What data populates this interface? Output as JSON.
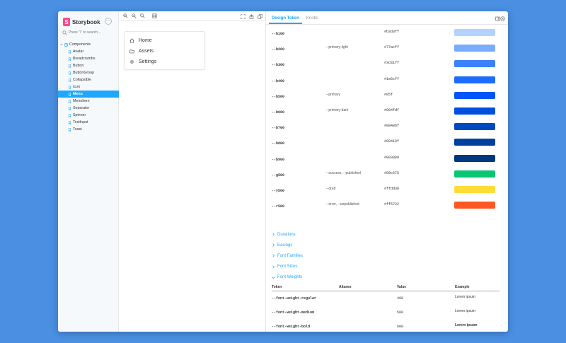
{
  "app": {
    "name": "Storybook",
    "logo_letter": "S",
    "menu_label": "···"
  },
  "search": {
    "placeholder": "Press \"/\" to search..."
  },
  "tree": {
    "root": "Components",
    "items": [
      "Avatar",
      "Breadcrumbs",
      "Button",
      "ButtonGroup",
      "Collapsible",
      "Icon",
      "Menu",
      "MenuItem",
      "Separator",
      "Spinner",
      "TextInput",
      "Toast"
    ],
    "active": "Menu"
  },
  "preview": {
    "nav": [
      {
        "label": "Home",
        "icon": "home-icon"
      },
      {
        "label": "Assets",
        "icon": "folder-icon"
      },
      {
        "label": "Settings",
        "icon": "gear-icon"
      }
    ]
  },
  "addons": {
    "tabs": [
      "Design Token",
      "Knobs"
    ],
    "active_tab": "Design Token"
  },
  "tokens": [
    {
      "name": "--b100",
      "alias": "",
      "value": "#b3d3ff",
      "color": "#b3d3ff"
    },
    {
      "name": "--b200",
      "alias": "--primary-light",
      "value": "#77acff",
      "color": "#77acff"
    },
    {
      "name": "--b300",
      "alias": "",
      "value": "#3c81ff",
      "color": "#3c81ff"
    },
    {
      "name": "--b400",
      "alias": "",
      "value": "#1e6cff",
      "color": "#1e6cff"
    },
    {
      "name": "--b500",
      "alias": "--primary",
      "value": "#05f",
      "color": "#0055ff"
    },
    {
      "name": "--b600",
      "alias": "--primary-dark",
      "value": "#004fdf",
      "color": "#004fdf"
    },
    {
      "name": "--b700",
      "alias": "",
      "value": "#0048bf",
      "color": "#0048bf"
    },
    {
      "name": "--b800",
      "alias": "",
      "value": "#00419f",
      "color": "#00419f"
    },
    {
      "name": "--b900",
      "alias": "",
      "value": "#003880",
      "color": "#003880"
    },
    {
      "name": "--g500",
      "alias": "--success, --published",
      "value": "#09c675",
      "color": "#09c675"
    },
    {
      "name": "--y500",
      "alias": "--draft",
      "value": "#ffdd38",
      "color": "#ffdd38"
    },
    {
      "name": "--r500",
      "alias": "--error, --unpublished",
      "value": "#ff5722",
      "color": "#ff5722"
    }
  ],
  "sections": [
    {
      "label": "Durations",
      "expanded": false
    },
    {
      "label": "Easings",
      "expanded": false
    },
    {
      "label": "Font Families",
      "expanded": false
    },
    {
      "label": "Font Sizes",
      "expanded": false
    },
    {
      "label": "Font Weights",
      "expanded": true
    }
  ],
  "font_weights": {
    "headers": [
      "Token",
      "Aliases",
      "Value",
      "Example"
    ],
    "rows": [
      {
        "token": "--font-weight-regular",
        "alias": "",
        "value": "400",
        "example": "Lorem ipsum"
      },
      {
        "token": "--font-weight-medium",
        "alias": "",
        "value": "500",
        "example": "Lorem ipsum"
      },
      {
        "token": "--font-weight-bold",
        "alias": "",
        "value": "600",
        "example": "Lorem ipsum"
      }
    ]
  },
  "colors": {
    "accent": "#1ea7fd",
    "brand": "#ff4785",
    "background": "#4a8fe2"
  }
}
